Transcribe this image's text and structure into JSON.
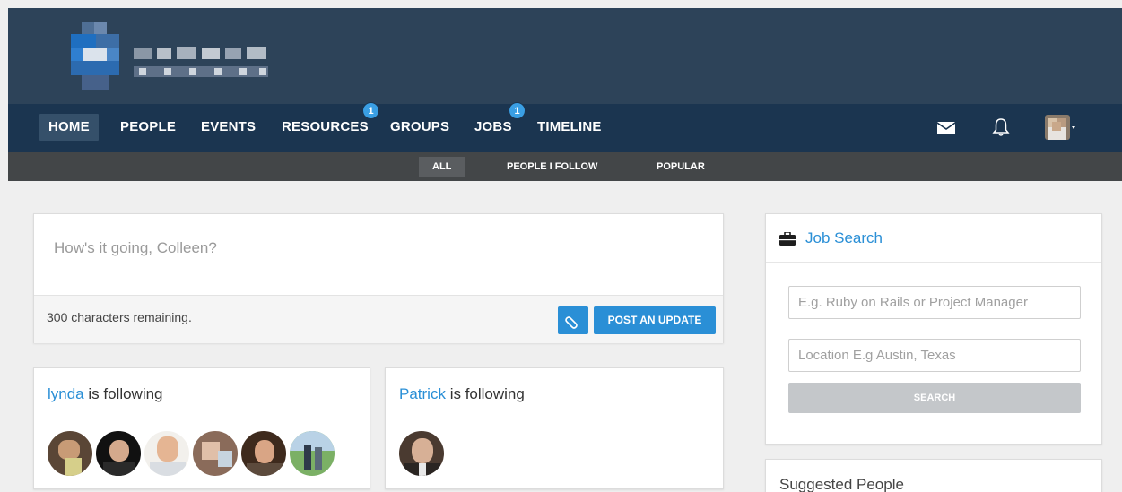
{
  "nav": {
    "items": [
      {
        "label": "HOME"
      },
      {
        "label": "PEOPLE"
      },
      {
        "label": "EVENTS"
      },
      {
        "label": "RESOURCES",
        "badge": "1"
      },
      {
        "label": "GROUPS"
      },
      {
        "label": "JOBS",
        "badge": "1"
      },
      {
        "label": "TIMELINE"
      }
    ],
    "icons": [
      "mail-icon",
      "bell-icon",
      "user-avatar-menu"
    ]
  },
  "subnav": {
    "items": [
      {
        "label": "ALL"
      },
      {
        "label": "PEOPLE I FOLLOW"
      },
      {
        "label": "POPULAR"
      }
    ]
  },
  "composer": {
    "placeholder": "How's it going, Colleen?",
    "chars_remaining": "300 characters remaining.",
    "post_label": "POST AN UPDATE"
  },
  "following": [
    {
      "name": "lynda",
      "suffix": " is following"
    },
    {
      "name": "Patrick",
      "suffix": " is following"
    }
  ],
  "job_search": {
    "title": "Job Search",
    "keyword_placeholder": "E.g. Ruby on Rails or Project Manager",
    "location_placeholder": "Location E.g Austin, Texas",
    "search_label": "SEARCH"
  },
  "suggested": {
    "title": "Suggested People"
  },
  "colors": {
    "accent": "#2a8fd6",
    "topbar": "#2d4359",
    "navbar": "#1b3550",
    "subnav": "#434648"
  }
}
